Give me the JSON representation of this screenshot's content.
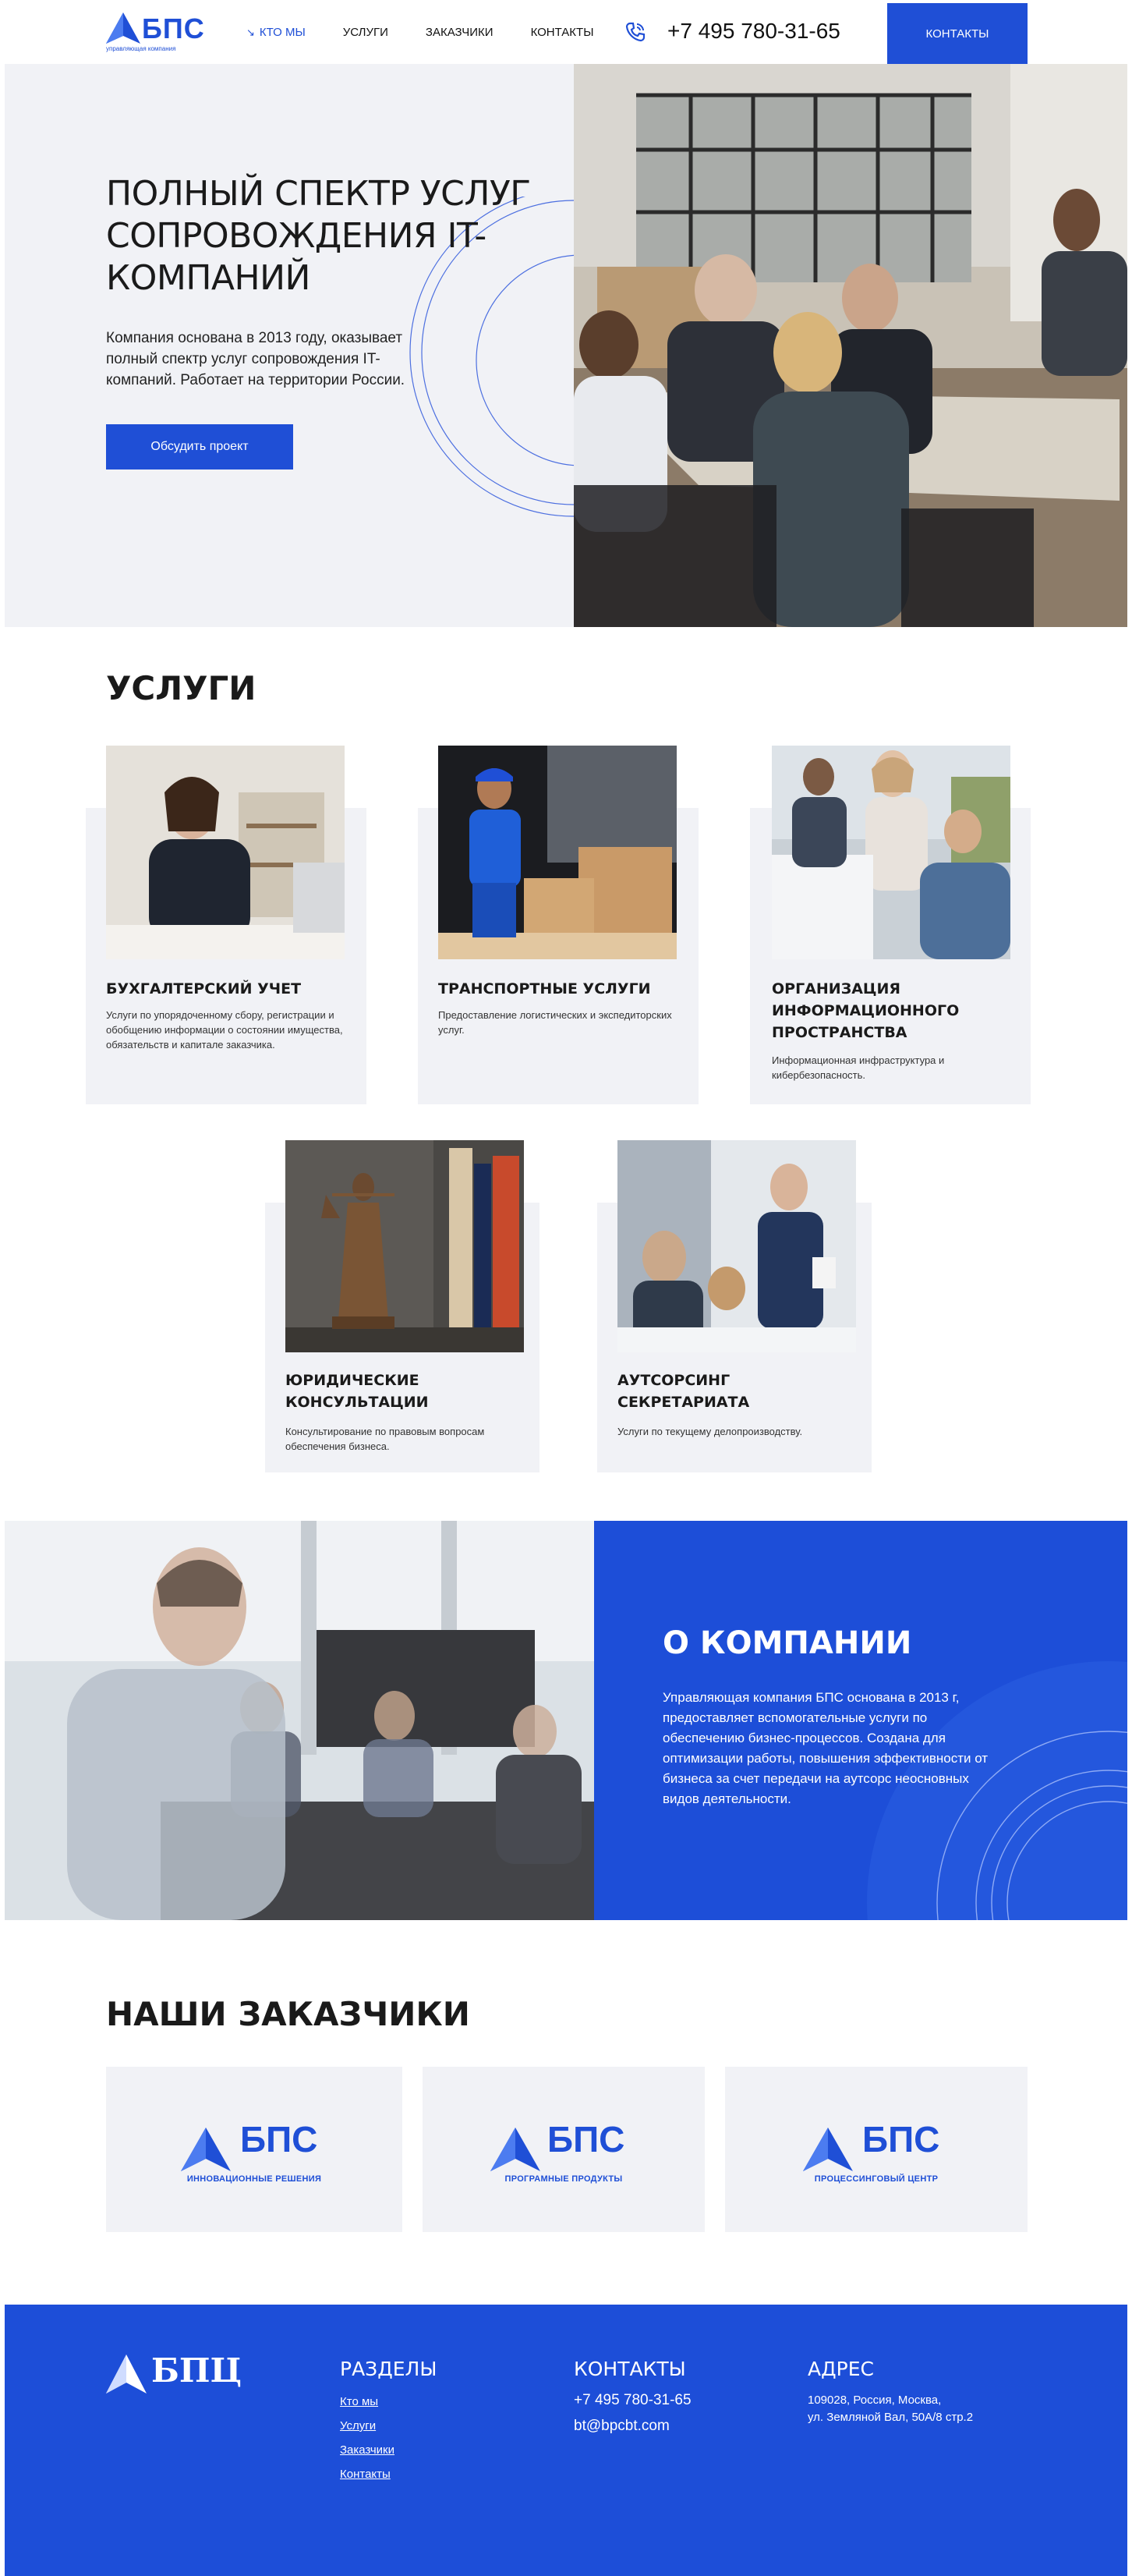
{
  "header": {
    "logo_text": "БПС",
    "logo_sub": "управляющая компания",
    "nav": [
      {
        "label": "Кто мы",
        "active": true
      },
      {
        "label": "Услуги",
        "active": false
      },
      {
        "label": "Заказчики",
        "active": false
      },
      {
        "label": "Контакты",
        "active": false
      }
    ],
    "phone": "+7 495 780-31-65",
    "contact_button": "Контакты"
  },
  "hero": {
    "title": "Полный спектр услуг сопровождения IT-компаний",
    "description": "Компания основана в 2013 году, оказывает полный спектр услуг сопровождения IT-компаний. Работает на территории России.",
    "button": "Обсудить проект",
    "photo": "office-meeting-photo"
  },
  "services": {
    "title": "Услуги",
    "items": [
      {
        "title": "Бухгалтерский учет",
        "desc": "Услуги по упорядоченному сбору, регистрации и обобщению информации о состоянии имущества, обязательств и капитале заказчика.",
        "photo": "accountant-photo"
      },
      {
        "title": "Транспортные услуги",
        "desc": "Предоставление логистических и экспедиторских услуг.",
        "photo": "courier-photo"
      },
      {
        "title": "Организация информационного пространства",
        "desc": "Информационная инфраструктура и кибербезопасность.",
        "photo": "it-team-photo"
      },
      {
        "title": "Юридические консультации",
        "desc": "Консультирование по правовым вопросам обеспечения бизнеса.",
        "photo": "themis-statue-photo"
      },
      {
        "title": "Аутсорсинг секретариата",
        "desc": "Услуги по текущему делопроизводству.",
        "photo": "presentation-photo"
      }
    ]
  },
  "about": {
    "title": "О компании",
    "text": "Управляющая компания БПС основана в 2013 г, предоставляет вспомогательные услуги по обеспечению бизнес-процессов. Создана для оптимизации работы, повышения эффективности от бизнеса за счет передачи на аутсорс неосновных видов деятельности.",
    "photo": "business-presentation-photo"
  },
  "clients": {
    "title": "Наши заказчики",
    "items": [
      {
        "name": "БПС",
        "sub": "Инновационные решения"
      },
      {
        "name": "БПС",
        "sub": "Програмные продукты"
      },
      {
        "name": "БПС",
        "sub": "Процессинговый центр"
      }
    ]
  },
  "footer": {
    "logo_text": "БПЦ",
    "sections_title": "Разделы",
    "links": [
      "Кто мы",
      "Услуги",
      "Заказчики",
      "Контакты"
    ],
    "contacts_title": "Контакты",
    "phone": "+7 495 780-31-65",
    "email": "bt@bpcbt.com",
    "address_title": "Адрес",
    "address_line1": "109028, Россия, Москва,",
    "address_line2": "ул. Земляной Вал, 50А/8 стр.2"
  },
  "colors": {
    "brand_blue": "#1f4fd6",
    "light_bg": "#f1f2f6"
  }
}
